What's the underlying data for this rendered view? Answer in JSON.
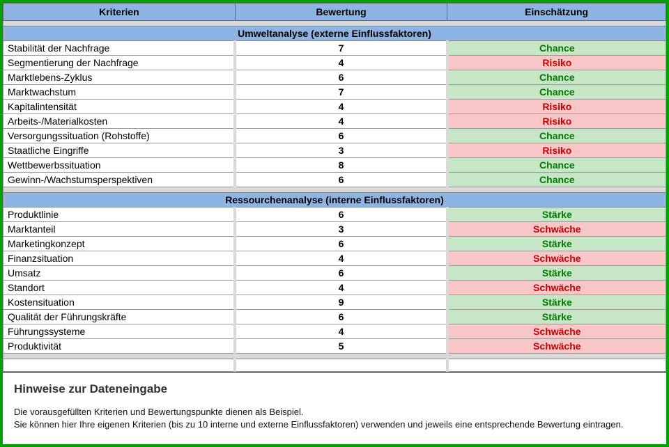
{
  "headers": {
    "criteria": "Kriterien",
    "rating": "Bewertung",
    "assessment": "Einschätzung"
  },
  "sections": [
    {
      "title": "Umweltanalyse (externe Einflussfaktoren)",
      "posLabel": "Chance",
      "negLabel": "Risiko",
      "rows": [
        {
          "criterion": "Stabilität der Nachfrage",
          "rating": 7,
          "assessment": "Chance",
          "tone": "pos"
        },
        {
          "criterion": "Segmentierung der Nachfrage",
          "rating": 4,
          "assessment": "Risiko",
          "tone": "neg"
        },
        {
          "criterion": "Marktlebens-Zyklus",
          "rating": 6,
          "assessment": "Chance",
          "tone": "pos"
        },
        {
          "criterion": "Marktwachstum",
          "rating": 7,
          "assessment": "Chance",
          "tone": "pos"
        },
        {
          "criterion": "Kapitalintensität",
          "rating": 4,
          "assessment": "Risiko",
          "tone": "neg"
        },
        {
          "criterion": "Arbeits-/Materialkosten",
          "rating": 4,
          "assessment": "Risiko",
          "tone": "neg"
        },
        {
          "criterion": "Versorgungssituation (Rohstoffe)",
          "rating": 6,
          "assessment": "Chance",
          "tone": "pos"
        },
        {
          "criterion": "Staatliche Eingriffe",
          "rating": 3,
          "assessment": "Risiko",
          "tone": "neg"
        },
        {
          "criterion": "Wettbewerbssituation",
          "rating": 8,
          "assessment": "Chance",
          "tone": "pos"
        },
        {
          "criterion": "Gewinn-/Wachstumsperspektiven",
          "rating": 6,
          "assessment": "Chance",
          "tone": "pos"
        }
      ]
    },
    {
      "title": "Ressourchenanalyse (interne Einflussfaktoren)",
      "posLabel": "Stärke",
      "negLabel": "Schwäche",
      "rows": [
        {
          "criterion": "Produktlinie",
          "rating": 6,
          "assessment": "Stärke",
          "tone": "pos"
        },
        {
          "criterion": "Marktanteil",
          "rating": 3,
          "assessment": "Schwäche",
          "tone": "neg"
        },
        {
          "criterion": "Marketingkonzept",
          "rating": 6,
          "assessment": "Stärke",
          "tone": "pos"
        },
        {
          "criterion": "Finanzsituation",
          "rating": 4,
          "assessment": "Schwäche",
          "tone": "neg"
        },
        {
          "criterion": "Umsatz",
          "rating": 6,
          "assessment": "Stärke",
          "tone": "pos"
        },
        {
          "criterion": "Standort",
          "rating": 4,
          "assessment": "Schwäche",
          "tone": "neg"
        },
        {
          "criterion": "Kostensituation",
          "rating": 9,
          "assessment": "Stärke",
          "tone": "pos"
        },
        {
          "criterion": "Qualität der Führungskräfte",
          "rating": 6,
          "assessment": "Stärke",
          "tone": "pos"
        },
        {
          "criterion": "Führungssysteme",
          "rating": 4,
          "assessment": "Schwäche",
          "tone": "neg"
        },
        {
          "criterion": "Produktivität",
          "rating": 5,
          "assessment": "Schwäche",
          "tone": "neg"
        }
      ]
    }
  ],
  "notes": {
    "title": "Hinweise zur Dateneingabe",
    "line1": "Die vorausgefüllten Kriterien und Bewertungspunkte dienen als Beispiel.",
    "line2": "Sie können hier Ihre eigenen Kriterien (bis zu 10 interne und externe Einflussfaktoren) verwenden und jeweils eine entsprechende Bewertung eintragen."
  }
}
